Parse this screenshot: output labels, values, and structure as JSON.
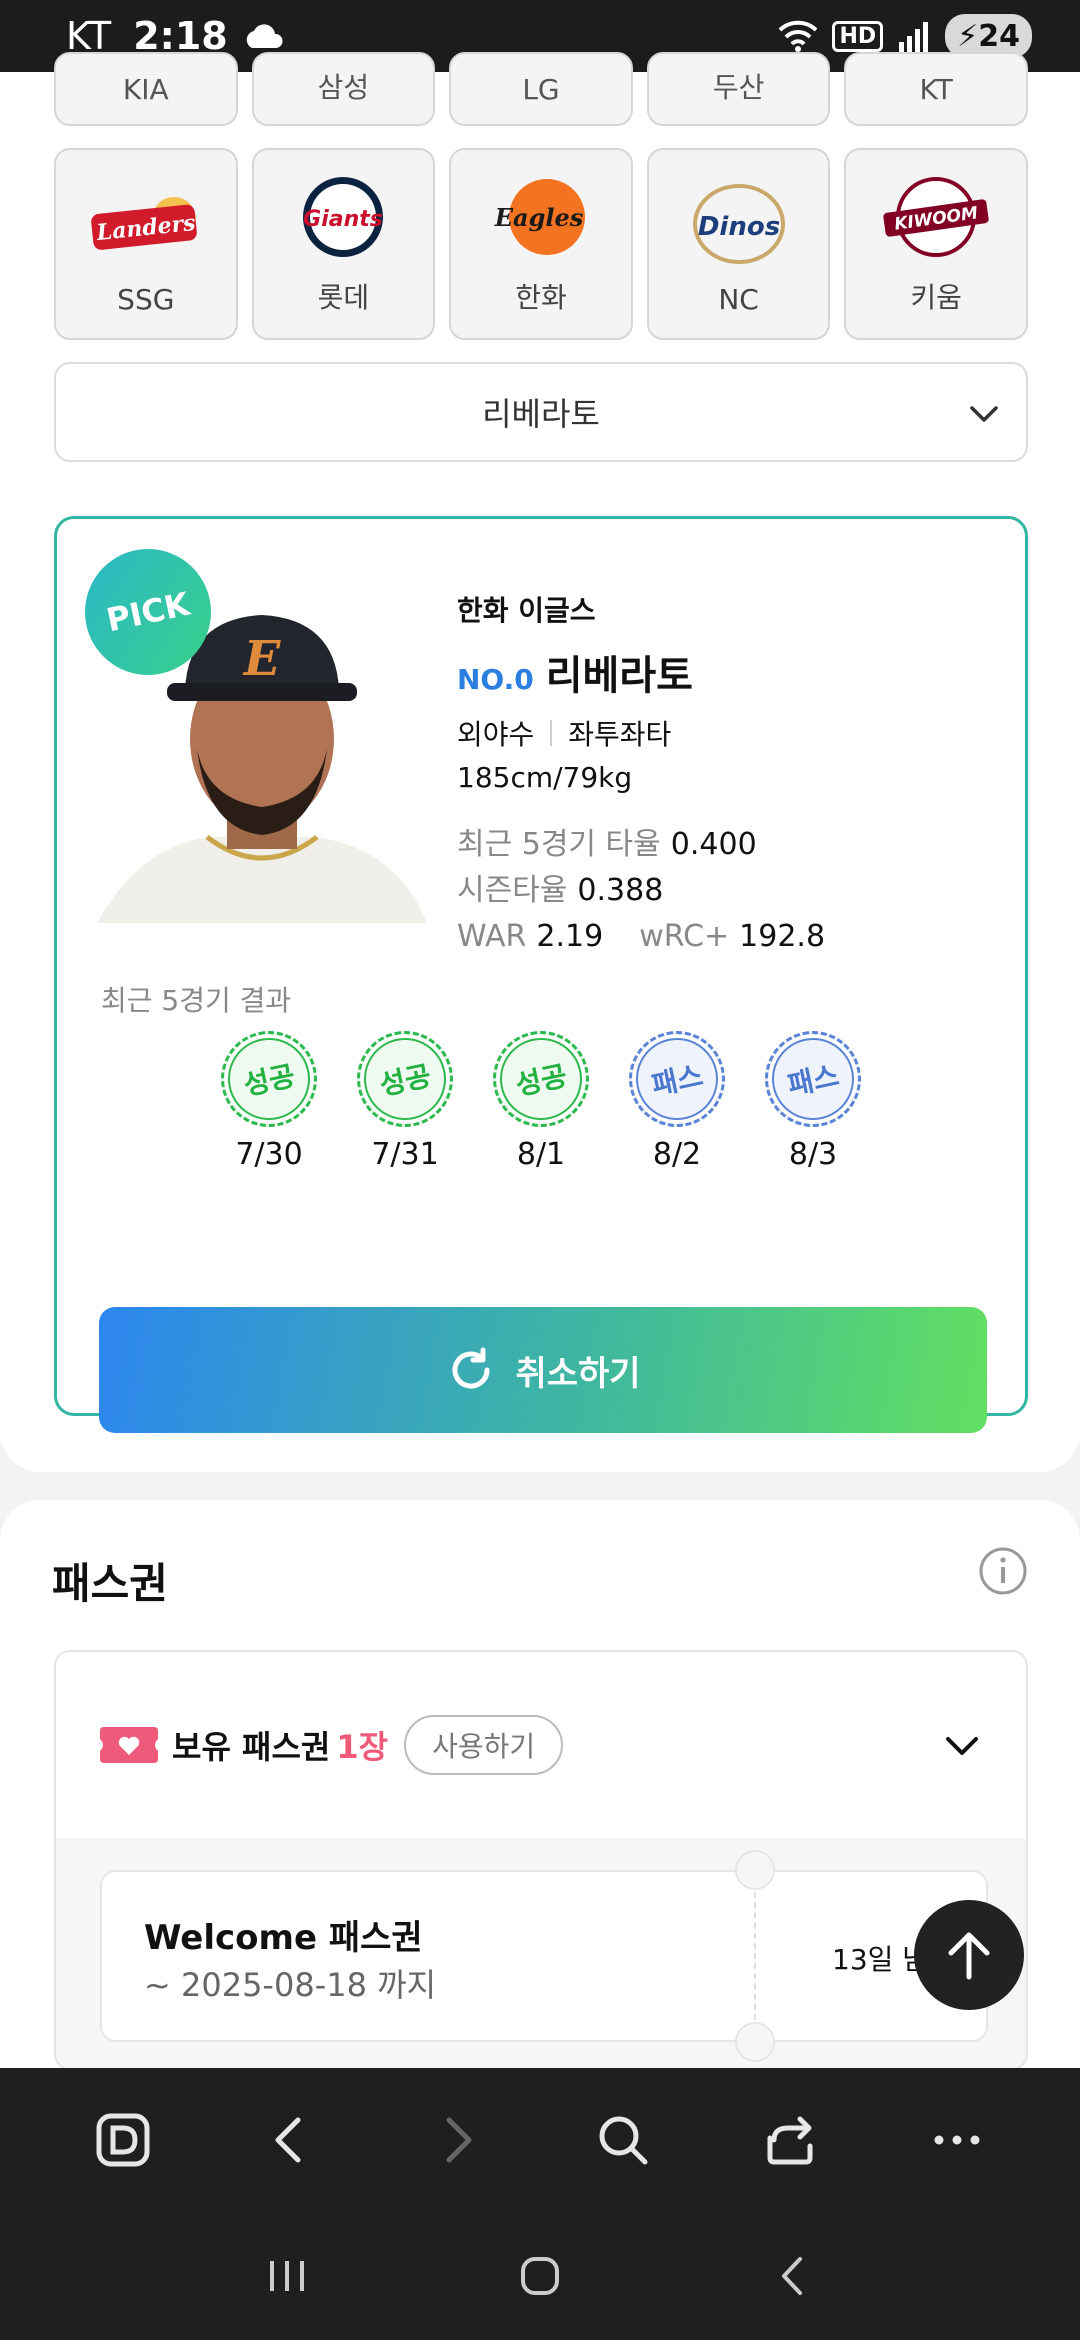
{
  "status": {
    "carrier": "KT",
    "time": "2:18",
    "battery": "24",
    "hd": "HD"
  },
  "teams_row1": [
    "KIA",
    "삼성",
    "LG",
    "두산",
    "KT"
  ],
  "teams_row2": [
    {
      "name": "SSG",
      "logo_text": "Landers",
      "color": "#d11a2a"
    },
    {
      "name": "롯데",
      "logo_text": "Giants",
      "color": "#c8102e"
    },
    {
      "name": "한화",
      "logo_text": "Eagles",
      "color": "#f37321"
    },
    {
      "name": "NC",
      "logo_text": "Dinos",
      "color": "#1d3e7a"
    },
    {
      "name": "키움",
      "logo_text": "KIWOOM",
      "color": "#820024"
    }
  ],
  "player_select": {
    "value": "리베라토"
  },
  "player": {
    "badge": "PICK",
    "team": "한화 이글스",
    "number": "NO.0",
    "name": "리베라토",
    "position": "외야수",
    "hand": "좌투좌타",
    "size": "185cm/79kg",
    "recent_avg_label": "최근 5경기 타율",
    "recent_avg": "0.400",
    "season_avg_label": "시즌타율",
    "season_avg": "0.388",
    "war_label": "WAR",
    "war": "2.19",
    "wrc_label": "wRC+",
    "wrc": "192.8"
  },
  "recent": {
    "title": "최근 5경기 결과",
    "games": [
      {
        "result": "성공",
        "date": "7/30"
      },
      {
        "result": "성공",
        "date": "7/31"
      },
      {
        "result": "성공",
        "date": "8/1"
      },
      {
        "result": "패스",
        "date": "8/2"
      },
      {
        "result": "패스",
        "date": "8/3"
      }
    ]
  },
  "cancel_label": "취소하기",
  "pass": {
    "title": "패스권",
    "own_label": "보유 패스권",
    "own_count": "1장",
    "use_label": "사용하기",
    "ticket_name": "Welcome 패스권",
    "ticket_date": "~ 2025-08-18 까지",
    "ticket_remain": "13일 남"
  },
  "colors": {
    "accent_blue": "#2a7fe0",
    "accent_green": "#62df61",
    "pink": "#ef5a7b"
  }
}
